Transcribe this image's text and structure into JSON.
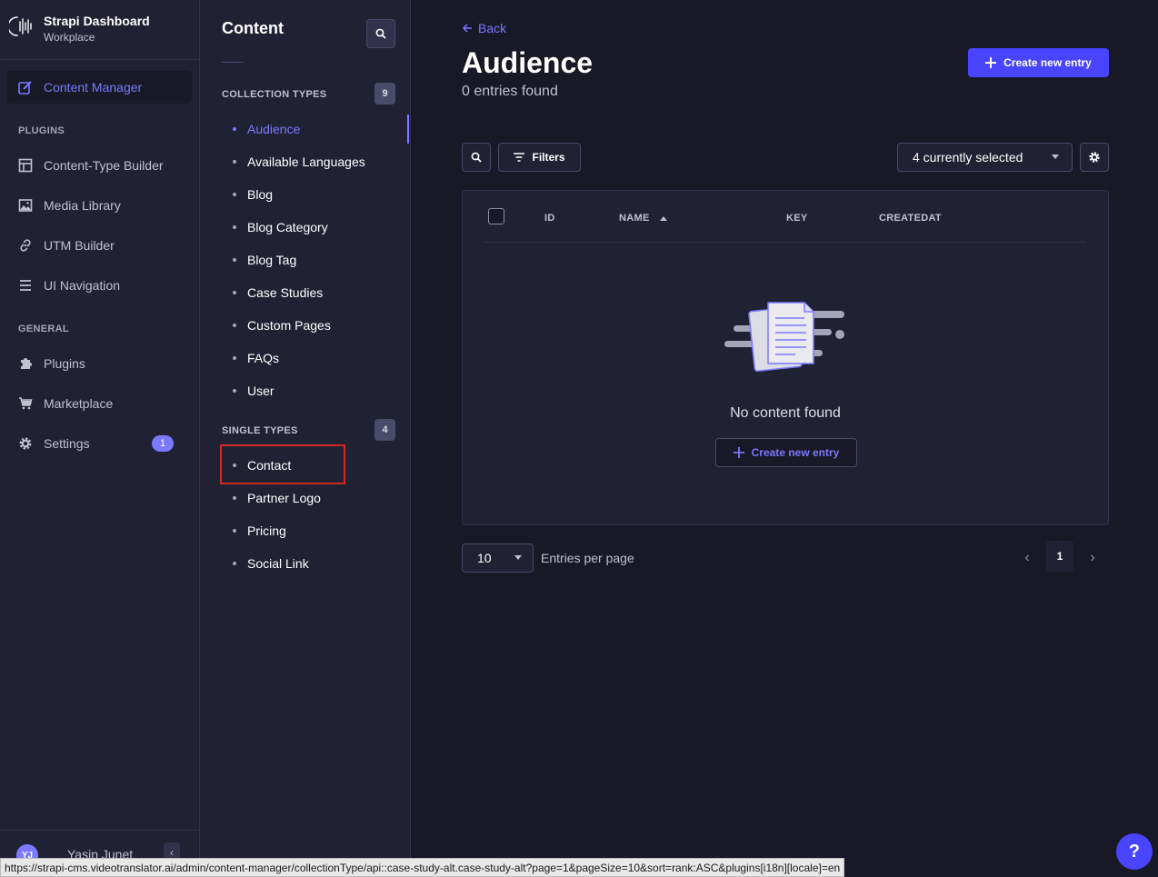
{
  "brand": {
    "title": "Strapi Dashboard",
    "subtitle": "Workplace"
  },
  "mainnav": {
    "content_manager": "Content Manager",
    "plugins_section": "PLUGINS",
    "plugins": [
      {
        "label": "Content-Type Builder",
        "icon": "layout-icon"
      },
      {
        "label": "Media Library",
        "icon": "image-icon"
      },
      {
        "label": "UTM Builder",
        "icon": "link-icon"
      },
      {
        "label": "UI Navigation",
        "icon": "list-icon"
      }
    ],
    "general_section": "GENERAL",
    "general": [
      {
        "label": "Plugins",
        "icon": "puzzle-icon"
      },
      {
        "label": "Marketplace",
        "icon": "cart-icon"
      },
      {
        "label": "Settings",
        "icon": "gear-icon",
        "badge": "1"
      }
    ]
  },
  "profile": {
    "initials": "YJ",
    "name": "Yasin Junet"
  },
  "subnav": {
    "title": "Content",
    "collection_types_label": "COLLECTION TYPES",
    "collection_types_count": "9",
    "collection_types": [
      "Audience",
      "Available Languages",
      "Blog",
      "Blog Category",
      "Blog Tag",
      "Case Studies",
      "Custom Pages",
      "FAQs",
      "User"
    ],
    "single_types_label": "SINGLE TYPES",
    "single_types_count": "4",
    "single_types": [
      "Contact",
      "Partner Logo",
      "Pricing",
      "Social Link"
    ]
  },
  "main": {
    "back": "Back",
    "title": "Audience",
    "subtitle": "0 entries found",
    "create_button": "Create new entry",
    "filters_button": "Filters",
    "columns_select": "4 currently selected",
    "table_headers": [
      "ID",
      "NAME",
      "KEY",
      "CREATEDAT"
    ],
    "empty_text": "No content found",
    "empty_create_button": "Create new entry",
    "page_size": "10",
    "per_page_label": "Entries per page",
    "current_page": "1"
  },
  "status_url": "https://strapi-cms.videotranslator.ai/admin/content-manager/collectionType/api::case-study-alt.case-study-alt?page=1&pageSize=10&sort=rank:ASC&plugins[i18n][locale]=en",
  "help_label": "?",
  "colors": {
    "accent": "#7b79ff",
    "primary": "#4945ff",
    "background": "#181826",
    "panel": "#212134",
    "highlight": "#d02b20"
  }
}
